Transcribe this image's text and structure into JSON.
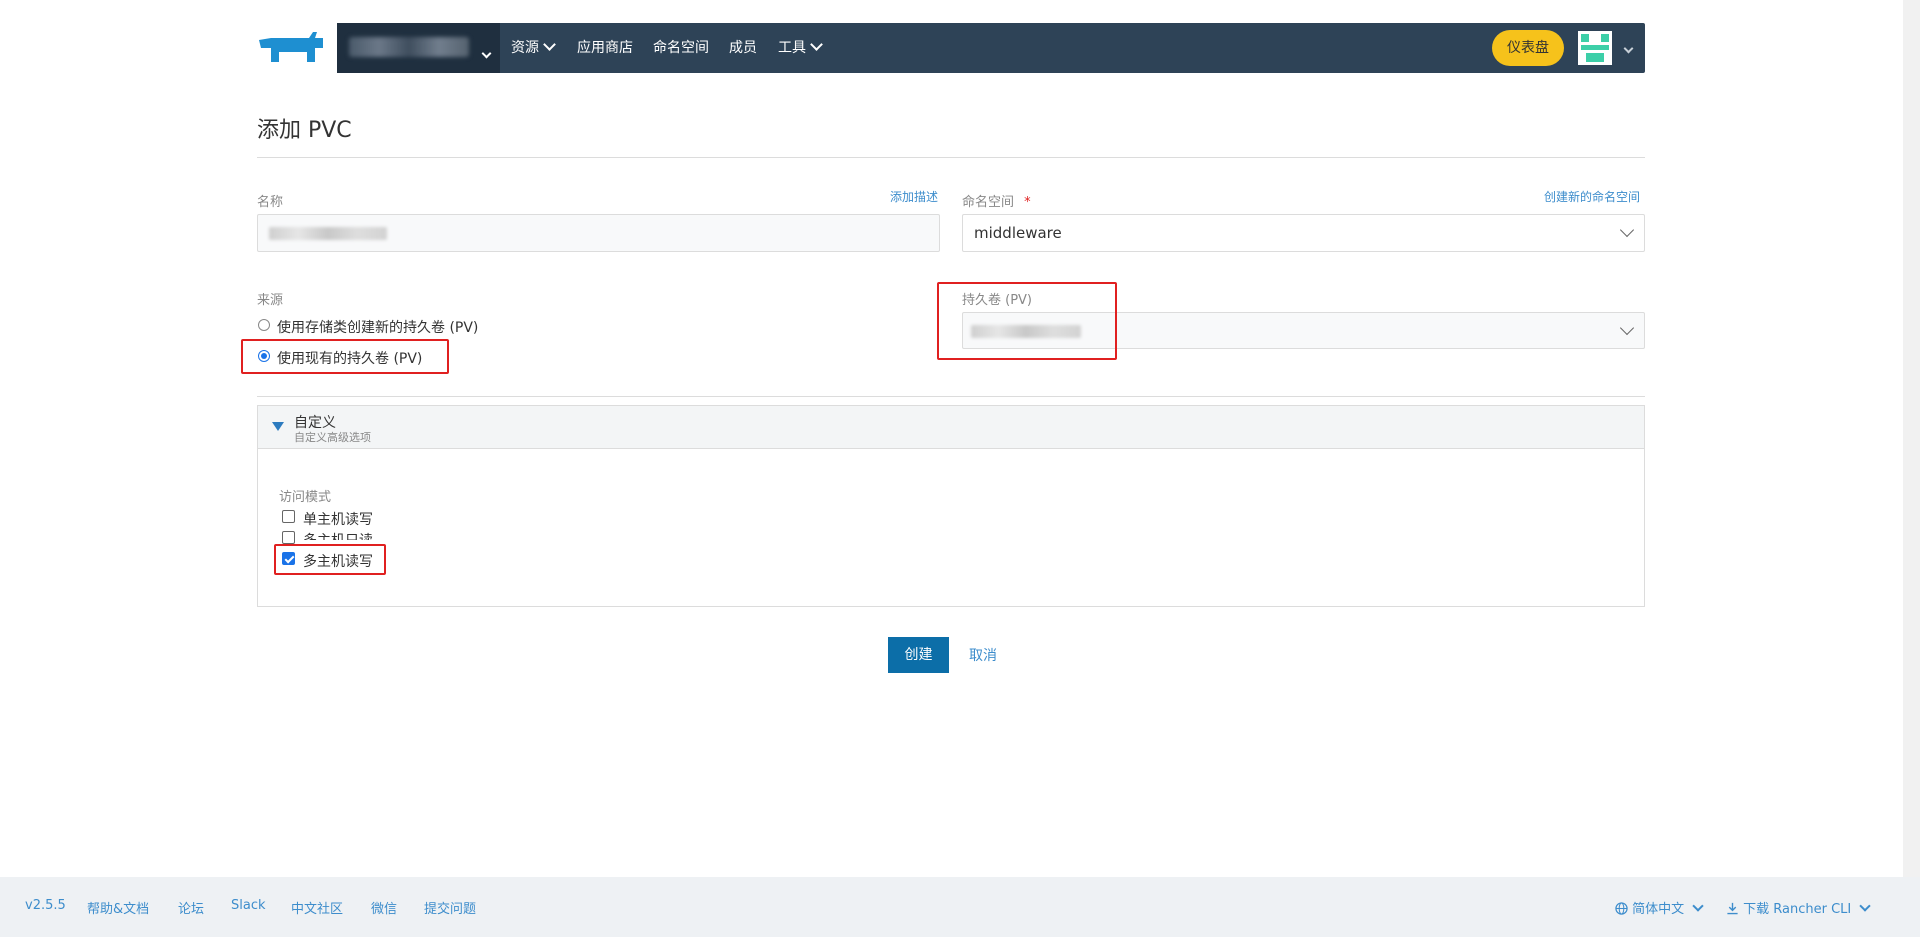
{
  "header": {
    "logo_icon": "rancher-cow-icon",
    "nav": [
      "资源",
      "应用商店",
      "命名空间",
      "成员",
      "工具"
    ],
    "dashboard_label": "仪表盘",
    "brand_color": "#2e4357",
    "accent_color": "#f6c21b"
  },
  "page": {
    "title": "添加 PVC"
  },
  "form": {
    "name_label": "名称",
    "add_desc_link": "添加描述",
    "namespace_label": "命名空间",
    "required_mark": "*",
    "create_ns_link": "创建新的命名空间",
    "namespace_value": "middleware",
    "source_label": "来源",
    "source_options": [
      "使用存储类创建新的持久卷 (PV)",
      "使用现有的持久卷 (PV)"
    ],
    "source_selected_index": 1,
    "pv_label": "持久卷 (PV)"
  },
  "custom": {
    "title": "自定义",
    "subtitle": "自定义高级选项",
    "access_mode_label": "访问模式",
    "access_modes": [
      {
        "label": "单主机读写",
        "checked": false
      },
      {
        "label": "多主机只读",
        "checked": false
      },
      {
        "label": "多主机读写",
        "checked": true
      }
    ]
  },
  "actions": {
    "create": "创建",
    "cancel": "取消"
  },
  "footer": {
    "version": "v2.5.5",
    "links": [
      "帮助&文档",
      "论坛",
      "Slack",
      "中文社区",
      "微信",
      "提交问题"
    ],
    "language": "简体中文",
    "download": "下载 Rancher CLI"
  }
}
